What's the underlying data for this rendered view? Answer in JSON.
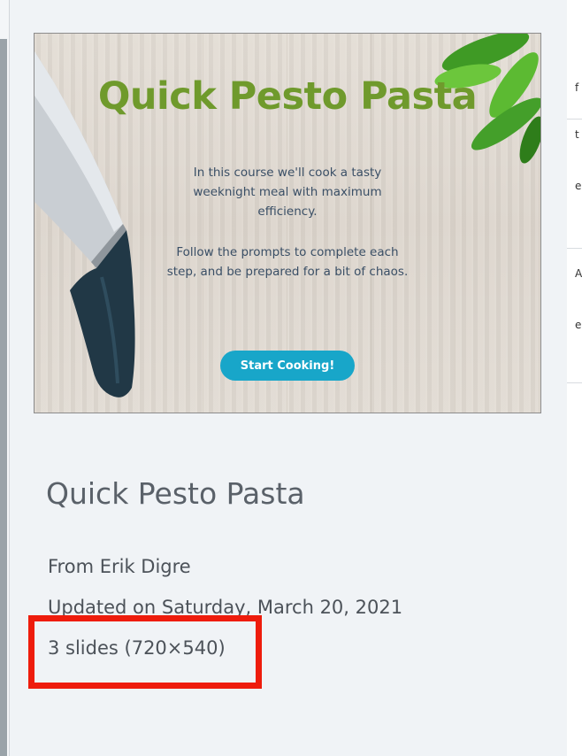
{
  "slide_preview": {
    "title": "Quick Pesto Pasta",
    "paragraphs": [
      "In this course we'll cook a tasty weeknight meal with maximum efficiency.",
      "Follow the prompts to complete each step, and be prepared for a bit of chaos."
    ],
    "start_button_label": "Start Cooking!"
  },
  "details": {
    "title": "Quick Pesto Pasta",
    "author": "From Erik Digre",
    "updated": "Updated on Saturday, March 20, 2021",
    "slides_info": "3 slides (720×540)"
  },
  "right_edge_fragments": [
    "f",
    "t",
    "e",
    "A",
    "e"
  ],
  "colors": {
    "title_green": "#6f9a2c",
    "button_teal": "#18a6c9",
    "highlight_red": "#ee1c0c",
    "panel_bg": "#f0f3f6"
  },
  "icons": {
    "knife": "knife-illustration",
    "basil": "basil-leaves-illustration"
  }
}
